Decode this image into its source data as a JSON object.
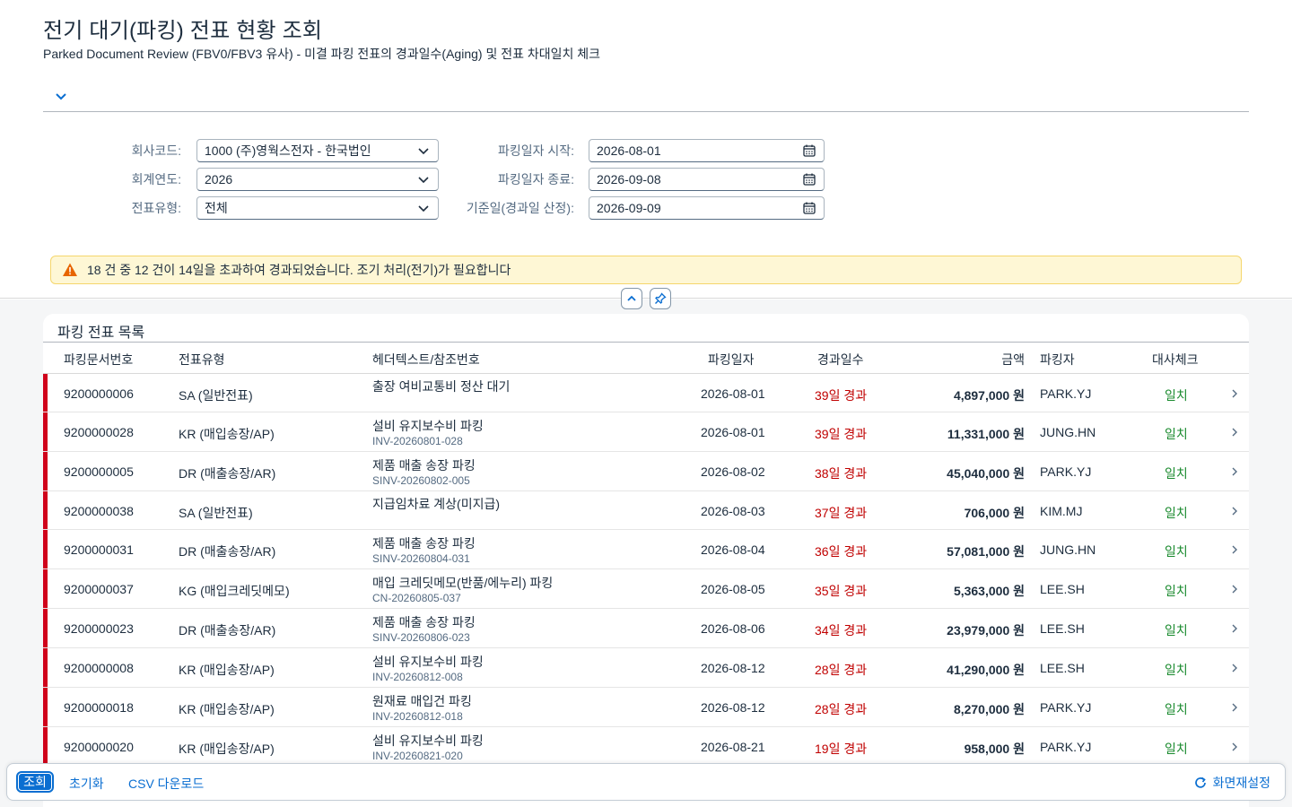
{
  "page": {
    "title": "전기 대기(파킹) 전표 현황 조회",
    "subtitle": "Parked Document Review (FBV0/FBV3 유사) - 미결 파킹 전표의 경과일수(Aging) 및 전표 차대일치 체크"
  },
  "filters": {
    "company_code_label": "회사코드:",
    "company_code_value": "1000 (주)영웍스전자 - 한국법인",
    "fiscal_year_label": "회계연도:",
    "fiscal_year_value": "2026",
    "doc_type_label": "전표유형:",
    "doc_type_value": "전체",
    "park_from_label": "파킹일자 시작:",
    "park_from_value": "2026-08-01",
    "park_to_label": "파킹일자 종료:",
    "park_to_value": "2026-09-08",
    "ref_date_label": "기준일(경과일 산정):",
    "ref_date_value": "2026-09-09"
  },
  "warning": {
    "text": "18 건 중 12 건이 14일을 초과하여 경과되었습니다. 조기 처리(전기)가 필요합니다"
  },
  "table": {
    "title": "파킹 전표 목록",
    "columns": {
      "docno": "파킹문서번호",
      "doctype": "전표유형",
      "hdr": "헤더텍스트/참조번호",
      "pdate": "파킹일자",
      "aging": "경과일수",
      "amount": "금액",
      "user": "파킹자",
      "check": "대사체크"
    },
    "rows": [
      {
        "docno": "9200000006",
        "doctype": "SA (일반전표)",
        "hdr": "출장 여비교통비 정산 대기",
        "ref": "",
        "pdate": "2026-08-01",
        "aging": "39일 경과",
        "amount": "4,897,000 원",
        "user": "PARK.YJ",
        "check": "일치"
      },
      {
        "docno": "9200000028",
        "doctype": "KR (매입송장/AP)",
        "hdr": "설비 유지보수비 파킹",
        "ref": "INV-20260801-028",
        "pdate": "2026-08-01",
        "aging": "39일 경과",
        "amount": "11,331,000 원",
        "user": "JUNG.HN",
        "check": "일치"
      },
      {
        "docno": "9200000005",
        "doctype": "DR (매출송장/AR)",
        "hdr": "제품 매출 송장 파킹",
        "ref": "SINV-20260802-005",
        "pdate": "2026-08-02",
        "aging": "38일 경과",
        "amount": "45,040,000 원",
        "user": "PARK.YJ",
        "check": "일치"
      },
      {
        "docno": "9200000038",
        "doctype": "SA (일반전표)",
        "hdr": "지급임차료 계상(미지급)",
        "ref": "",
        "pdate": "2026-08-03",
        "aging": "37일 경과",
        "amount": "706,000 원",
        "user": "KIM.MJ",
        "check": "일치"
      },
      {
        "docno": "9200000031",
        "doctype": "DR (매출송장/AR)",
        "hdr": "제품 매출 송장 파킹",
        "ref": "SINV-20260804-031",
        "pdate": "2026-08-04",
        "aging": "36일 경과",
        "amount": "57,081,000 원",
        "user": "JUNG.HN",
        "check": "일치"
      },
      {
        "docno": "9200000037",
        "doctype": "KG (매입크레딧메모)",
        "hdr": "매입 크레딧메모(반품/에누리) 파킹",
        "ref": "CN-20260805-037",
        "pdate": "2026-08-05",
        "aging": "35일 경과",
        "amount": "5,363,000 원",
        "user": "LEE.SH",
        "check": "일치"
      },
      {
        "docno": "9200000023",
        "doctype": "DR (매출송장/AR)",
        "hdr": "제품 매출 송장 파킹",
        "ref": "SINV-20260806-023",
        "pdate": "2026-08-06",
        "aging": "34일 경과",
        "amount": "23,979,000 원",
        "user": "LEE.SH",
        "check": "일치"
      },
      {
        "docno": "9200000008",
        "doctype": "KR (매입송장/AP)",
        "hdr": "설비 유지보수비 파킹",
        "ref": "INV-20260812-008",
        "pdate": "2026-08-12",
        "aging": "28일 경과",
        "amount": "41,290,000 원",
        "user": "LEE.SH",
        "check": "일치"
      },
      {
        "docno": "9200000018",
        "doctype": "KR (매입송장/AP)",
        "hdr": "원재료 매입건 파킹",
        "ref": "INV-20260812-018",
        "pdate": "2026-08-12",
        "aging": "28일 경과",
        "amount": "8,270,000 원",
        "user": "PARK.YJ",
        "check": "일치"
      },
      {
        "docno": "9200000020",
        "doctype": "KR (매입송장/AP)",
        "hdr": "설비 유지보수비 파킹",
        "ref": "INV-20260821-020",
        "pdate": "2026-08-21",
        "aging": "19일 경과",
        "amount": "958,000 원",
        "user": "PARK.YJ",
        "check": "일치"
      }
    ]
  },
  "footer": {
    "search_label": "조회",
    "reset_label": "초기화",
    "csv_label": "CSV 다운로드",
    "layout_reset_label": "화면재설정"
  },
  "colors": {
    "accent": "#0a6ed1",
    "overdue_flag": "#d0021b",
    "aging_text": "#c00000",
    "match_text": "#1a8a2e",
    "warning_bg": "#fef7d5"
  }
}
